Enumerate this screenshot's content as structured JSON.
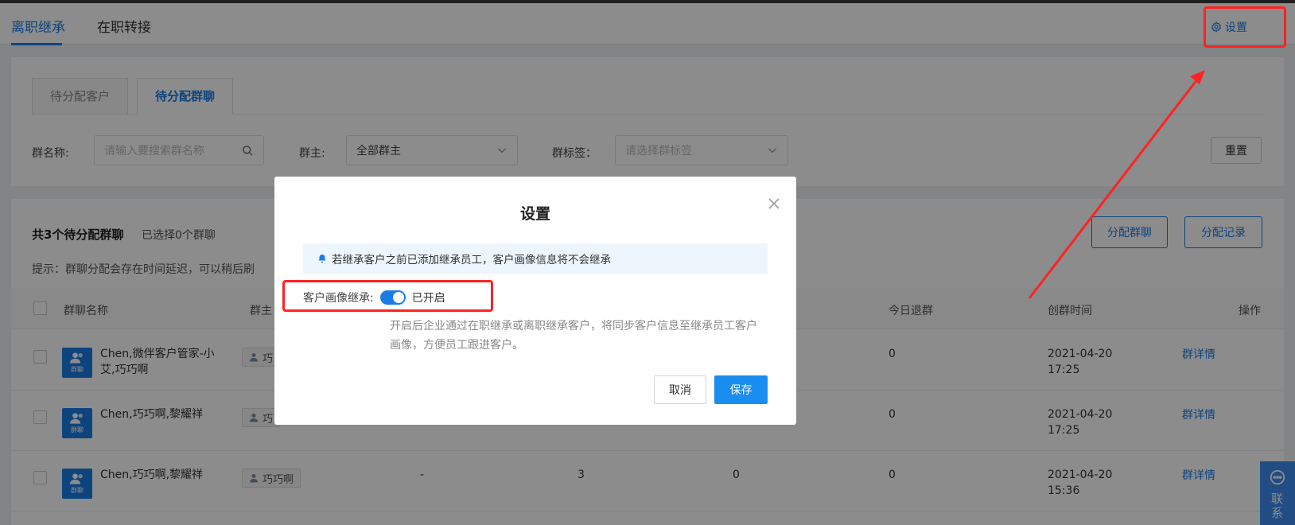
{
  "top_tabs": [
    {
      "label": "离职继承",
      "active": true
    },
    {
      "label": "在职转接",
      "active": false
    }
  ],
  "settings_link": {
    "label": "设置",
    "icon": "gear-icon"
  },
  "sub_tabs": [
    {
      "label": "待分配客户",
      "active": false
    },
    {
      "label": "待分配群聊",
      "active": true
    }
  ],
  "filters": {
    "group_name_label": "群名称:",
    "group_name_placeholder": "请输入要搜索群名称",
    "owner_label": "群主:",
    "owner_value": "全部群主",
    "tag_label": "群标签：",
    "tag_placeholder": "请选择群标签",
    "reset_label": "重置"
  },
  "list": {
    "summary": "共3个待分配群聊",
    "selected": "已选择0个群聊",
    "hint": "提示：群聊分配会存在时间延迟，可以稍后刷",
    "assign_button": "分配群聊",
    "record_button": "分配记录",
    "columns": {
      "name": "群聊名称",
      "owner": "群主",
      "quit_today": "今日退群",
      "created": "创群时间",
      "action": "操作"
    },
    "avatar_text": "群聊",
    "rows": [
      {
        "name": "Chen,微伴客户管家-小艾,巧巧啊",
        "owner": "巧",
        "col_a": "",
        "col_b": "",
        "col_c": "",
        "quit": "0",
        "date": "2021-04-20",
        "time": "17:25",
        "action": "群详情"
      },
      {
        "name": "Chen,巧巧啊,黎耀祥",
        "owner": "巧",
        "col_a": "",
        "col_b": "",
        "col_c": "",
        "quit": "0",
        "date": "2021-04-20",
        "time": "17:25",
        "action": "群详情"
      },
      {
        "name": "Chen,巧巧啊,黎耀祥",
        "owner": "巧巧啊",
        "col_a": "-",
        "col_b": "3",
        "col_c": "0",
        "quit": "0",
        "date": "2021-04-20",
        "time": "15:36",
        "action": "群详情"
      }
    ]
  },
  "side_contact": {
    "label": "联系"
  },
  "modal": {
    "title": "设置",
    "alert": "若继承客户之前已添加继承员工，客户画像信息将不会继承",
    "inherit_label": "客户画像继承:",
    "toggle_on": true,
    "toggle_text": "已开启",
    "description": "开启后企业通过在职继承或离职继承客户，将同步客户信息至继承员工客户画像，方便员工跟进客户。",
    "cancel_label": "取消",
    "save_label": "保存"
  },
  "colors": {
    "accent": "#1a7de6",
    "annotation_red": "#ff2222",
    "overlay": "rgba(0,0,0,0.45)"
  }
}
